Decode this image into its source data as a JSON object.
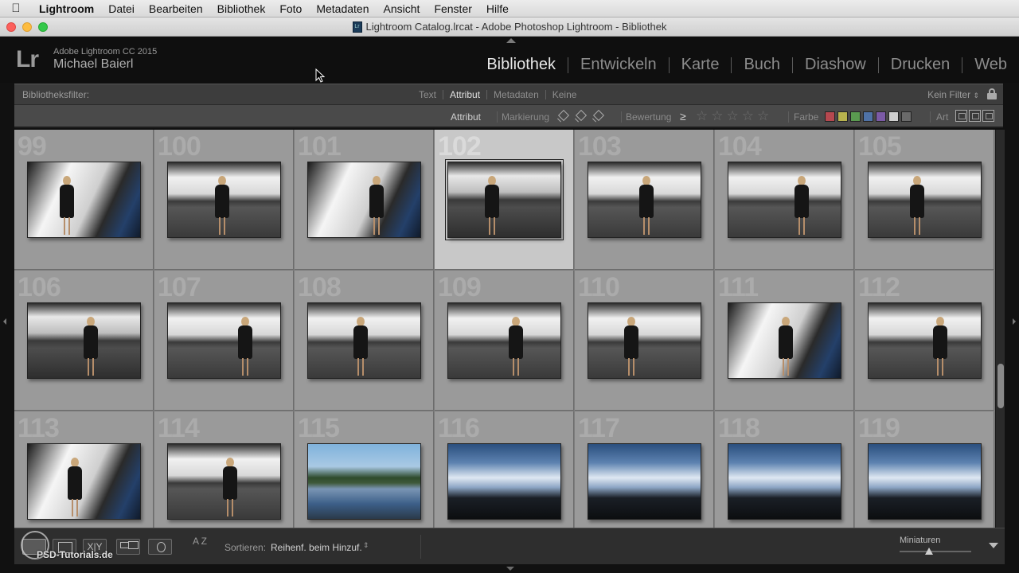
{
  "menubar": {
    "app": "Lightroom",
    "items": [
      "Datei",
      "Bearbeiten",
      "Bibliothek",
      "Foto",
      "Metadaten",
      "Ansicht",
      "Fenster",
      "Hilfe"
    ]
  },
  "window": {
    "title": "Lightroom Catalog.lrcat - Adobe Photoshop Lightroom - Bibliothek"
  },
  "identity": {
    "logo": "Lr",
    "version": "Adobe Lightroom CC 2015",
    "user": "Michael Baierl"
  },
  "modules": [
    "Bibliothek",
    "Entwickeln",
    "Karte",
    "Buch",
    "Diashow",
    "Drucken",
    "Web"
  ],
  "active_module": "Bibliothek",
  "filter": {
    "label": "Bibliotheksfilter:",
    "tabs": [
      "Text",
      "Attribut",
      "Metadaten",
      "Keine"
    ],
    "active_tab": "Attribut",
    "preset": "Kein Filter",
    "attribute": {
      "label": "Attribut",
      "flag_label": "Markierung",
      "rating_label": "Bewertung",
      "rating_op": "≥",
      "color_label": "Farbe",
      "kind_label": "Art",
      "color_swatches": [
        "#b5484f",
        "#b8b34e",
        "#5a9a50",
        "#4f72a6",
        "#7b5aa6",
        "#cfcfcf",
        "#6a6a6a"
      ]
    }
  },
  "grid": {
    "selected": "102",
    "cells": [
      {
        "num": "99",
        "photo": "blue"
      },
      {
        "num": "100",
        "photo": "studio"
      },
      {
        "num": "101",
        "photo": "blue"
      },
      {
        "num": "102",
        "photo": "studio-dark"
      },
      {
        "num": "103",
        "photo": "studio"
      },
      {
        "num": "104",
        "photo": "studio"
      },
      {
        "num": "105",
        "photo": "studio"
      },
      {
        "num": "106",
        "photo": "studio-dark"
      },
      {
        "num": "107",
        "photo": "studio"
      },
      {
        "num": "108",
        "photo": "studio"
      },
      {
        "num": "109",
        "photo": "studio"
      },
      {
        "num": "110",
        "photo": "studio"
      },
      {
        "num": "111",
        "photo": "blue"
      },
      {
        "num": "112",
        "photo": "studio"
      },
      {
        "num": "113",
        "photo": "blue"
      },
      {
        "num": "114",
        "photo": "studio"
      },
      {
        "num": "115",
        "photo": "lake"
      },
      {
        "num": "116",
        "photo": "sky"
      },
      {
        "num": "117",
        "photo": "sky"
      },
      {
        "num": "118",
        "photo": "sky"
      },
      {
        "num": "119",
        "photo": "sky"
      }
    ]
  },
  "toolbar": {
    "sort_label": "Sortieren:",
    "sort_value": "Reihenf. beim Hinzuf.",
    "sort_icon": "A Z",
    "thumbnails_label": "Miniaturen"
  },
  "watermark": "PSD-Tutorials.de"
}
